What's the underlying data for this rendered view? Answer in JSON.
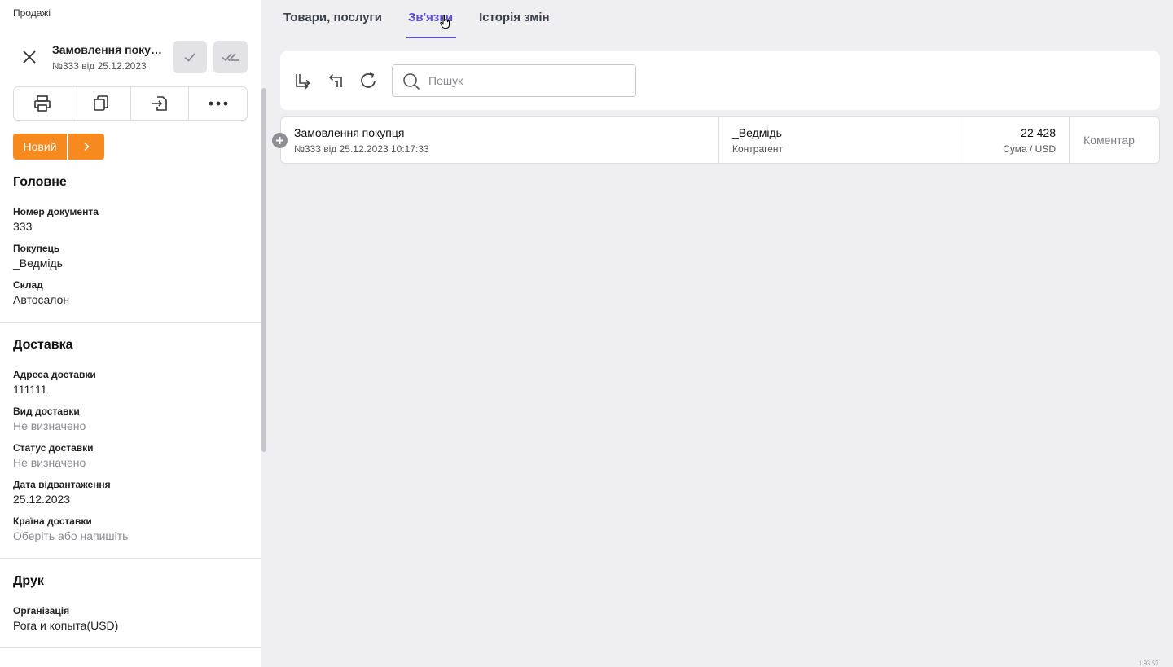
{
  "breadcrumb": "Продажі",
  "document": {
    "title": "Замовлення покупця",
    "subtitle": "№333 від 25.12.2023",
    "status_label": "Новий"
  },
  "sections": {
    "main": {
      "title": "Головне",
      "fields": [
        {
          "label": "Номер документа",
          "value": "333"
        },
        {
          "label": "Покупець",
          "value": "_Ведмідь"
        },
        {
          "label": "Склад",
          "value": "Автосалон"
        }
      ]
    },
    "delivery": {
      "title": "Доставка",
      "fields": [
        {
          "label": "Адреса доставки",
          "value": "111111"
        },
        {
          "label": "Вид доставки",
          "value": "Не визначено"
        },
        {
          "label": "Статус доставки",
          "value": "Не визначено"
        },
        {
          "label": "Дата відвантаження",
          "value": "25.12.2023"
        },
        {
          "label": "Країна доставки",
          "value": "Оберіть або напишіть"
        }
      ]
    },
    "print": {
      "title": "Друк",
      "fields": [
        {
          "label": "Організація",
          "value": "Рога и копыта(USD)"
        }
      ]
    }
  },
  "tabs": [
    {
      "label": "Товари, послуги"
    },
    {
      "label": "Зв'язки"
    },
    {
      "label": "Історія змін"
    }
  ],
  "search": {
    "placeholder": "Пошук"
  },
  "links": [
    {
      "name": "Замовлення покупця",
      "details": "№333 від 25.12.2023 10:17:33",
      "counterparty": "_Ведмідь",
      "counterparty_label": "Контрагент",
      "amount": "22 428",
      "amount_label": "Сума / USD",
      "comment": "Коментар"
    }
  ],
  "version": "1.93.57",
  "colors": {
    "accent": "#5b4fd6",
    "status": "#f68a1f"
  }
}
